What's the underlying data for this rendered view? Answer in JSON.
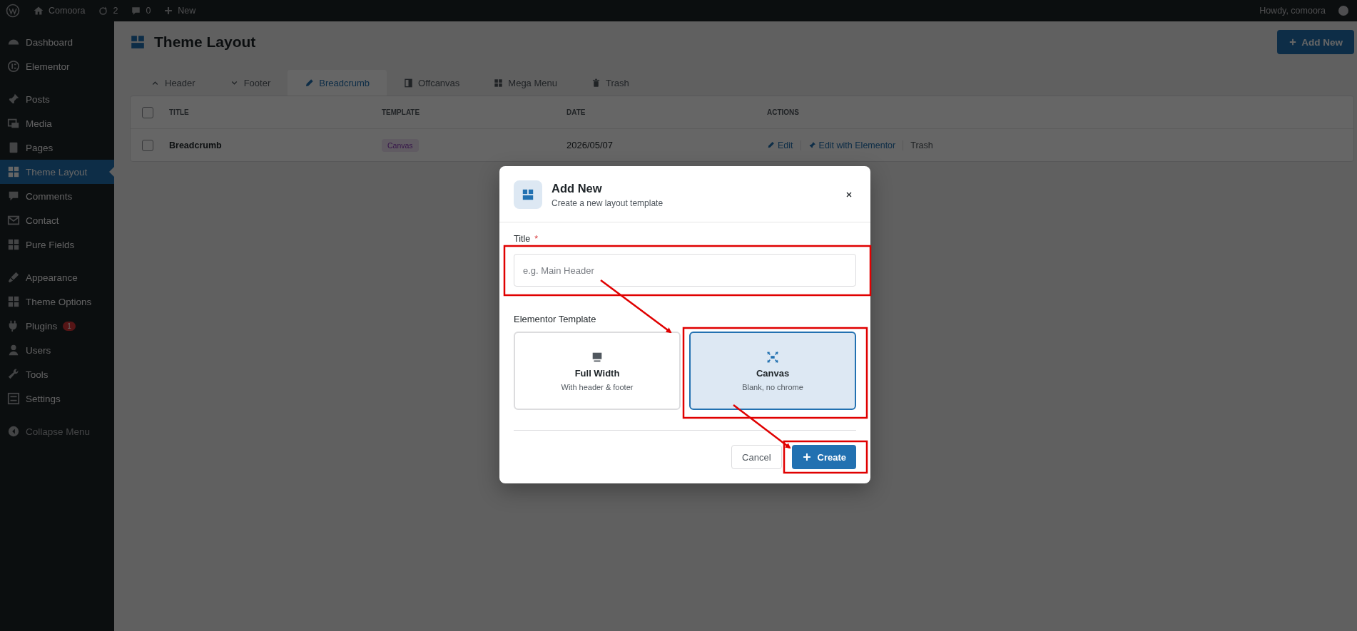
{
  "admin_bar": {
    "site_name": "Comoora",
    "updates": "2",
    "comments": "0",
    "new_label": "New",
    "greeting": "Howdy, comoora"
  },
  "sidebar": {
    "groups": [
      {
        "items": [
          {
            "label": "Dashboard",
            "selected": false
          },
          {
            "label": "Elementor",
            "selected": false
          }
        ]
      },
      {
        "items": [
          {
            "label": "Posts",
            "selected": false
          },
          {
            "label": "Media",
            "selected": false
          },
          {
            "label": "Pages",
            "selected": false
          },
          {
            "label": "Theme Layout",
            "selected": true
          },
          {
            "label": "Comments",
            "selected": false
          },
          {
            "label": "Contact",
            "selected": false
          },
          {
            "label": "Pure Fields",
            "selected": false
          }
        ]
      },
      {
        "items": [
          {
            "label": "Appearance",
            "selected": false
          },
          {
            "label": "Theme Options",
            "selected": false
          },
          {
            "label": "Plugins",
            "selected": false,
            "badge": "1"
          },
          {
            "label": "Users",
            "selected": false
          },
          {
            "label": "Tools",
            "selected": false
          },
          {
            "label": "Settings",
            "selected": false
          }
        ]
      }
    ],
    "collapse_label": "Collapse Menu"
  },
  "page": {
    "title": "Theme Layout",
    "add_button": "Add New",
    "tabs": [
      {
        "label": "Header",
        "selected": false
      },
      {
        "label": "Footer",
        "selected": false
      },
      {
        "label": "Breadcrumb",
        "selected": true
      },
      {
        "label": "Offcanvas",
        "selected": false
      },
      {
        "label": "Mega Menu",
        "selected": false
      },
      {
        "label": "Trash",
        "selected": false
      }
    ],
    "table": {
      "select_all_checked": false,
      "columns": [
        "TITLE",
        "TEMPLATE",
        "DATE",
        "ACTIONS"
      ],
      "rows": [
        {
          "checked": false,
          "title": "Breadcrumb",
          "template": "Canvas",
          "date": "2026/05/07",
          "actions": [
            {
              "label": "Edit",
              "kind": "edit"
            },
            {
              "label": "Edit with Elementor",
              "kind": "elementor"
            },
            {
              "label": "Trash",
              "kind": "trash"
            }
          ]
        }
      ]
    }
  },
  "modal": {
    "title": "Add New",
    "subtitle": "Create a new layout template",
    "field_label": "Title",
    "required_mark": "*",
    "placeholder": "e.g. Main Header",
    "template_label": "Elementor Template",
    "options": [
      {
        "name": "Full Width",
        "description": "With header & footer",
        "selected": false
      },
      {
        "name": "Canvas",
        "description": "Blank, no chrome",
        "selected": true
      }
    ],
    "cancel": "Cancel",
    "create": "Create"
  }
}
